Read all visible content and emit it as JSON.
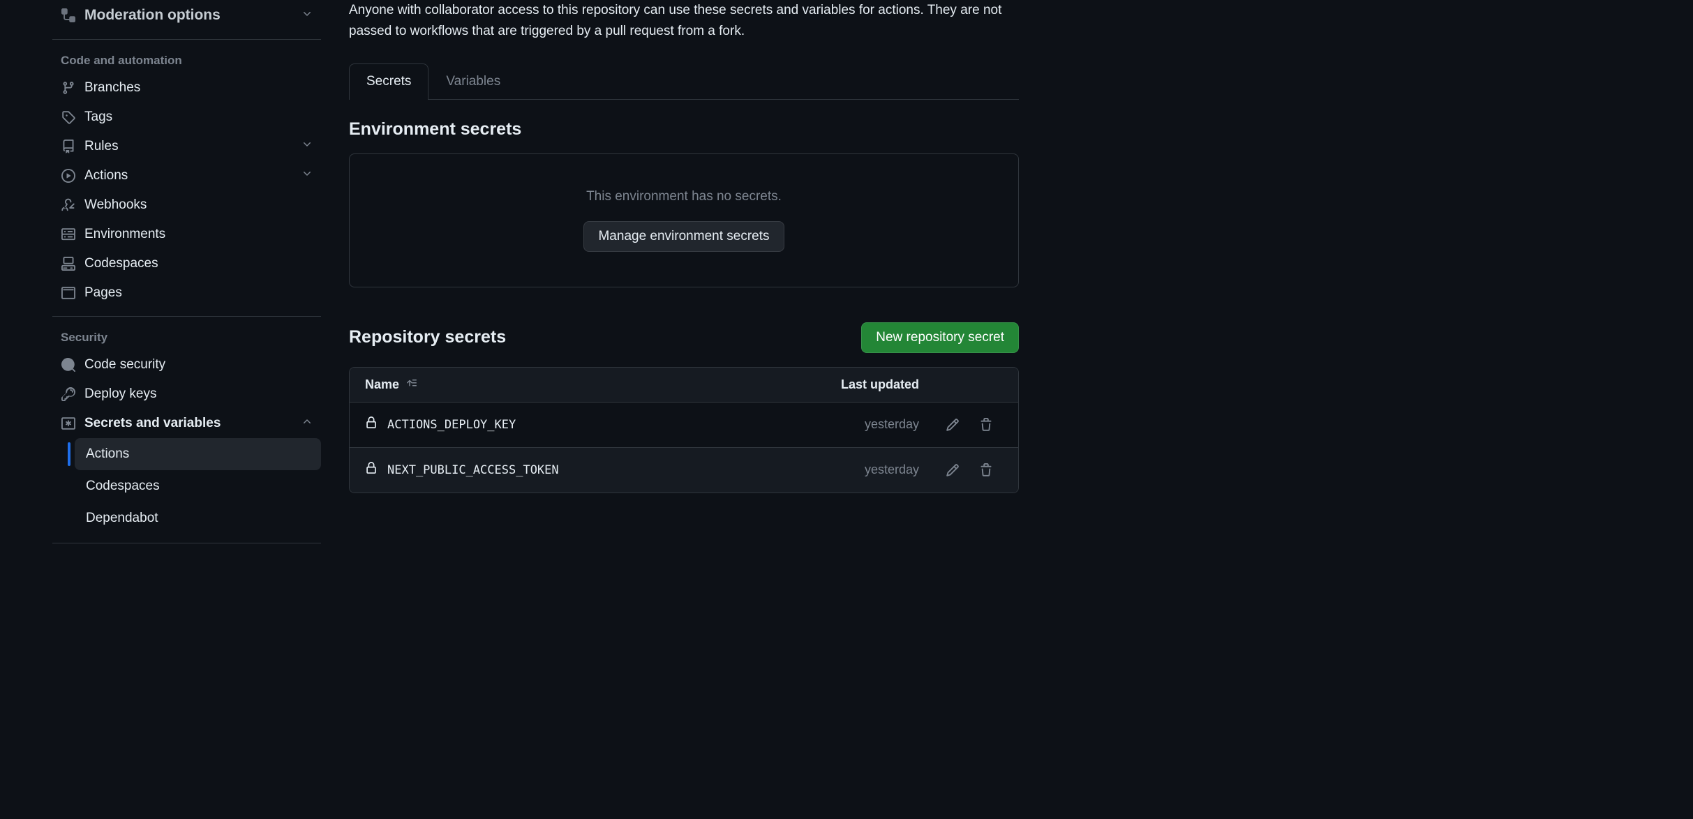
{
  "sidebar": {
    "top_item": "Moderation options",
    "sections": {
      "code_automation": {
        "header": "Code and automation",
        "items": {
          "branches": "Branches",
          "tags": "Tags",
          "rules": "Rules",
          "actions": "Actions",
          "webhooks": "Webhooks",
          "environments": "Environments",
          "codespaces": "Codespaces",
          "pages": "Pages"
        }
      },
      "security": {
        "header": "Security",
        "items": {
          "code_security": "Code security",
          "deploy_keys": "Deploy keys",
          "secrets_vars": "Secrets and variables"
        },
        "sub_items": {
          "actions": "Actions",
          "codespaces": "Codespaces",
          "dependabot": "Dependabot"
        }
      }
    }
  },
  "main": {
    "description": "Anyone with collaborator access to this repository can use these secrets and variables for actions. They are not passed to workflows that are triggered by a pull request from a fork.",
    "tabs": {
      "secrets": "Secrets",
      "variables": "Variables"
    },
    "env_section": {
      "title": "Environment secrets",
      "empty_text": "This environment has no secrets.",
      "manage_btn": "Manage environment secrets"
    },
    "repo_section": {
      "title": "Repository secrets",
      "new_btn": "New repository secret",
      "columns": {
        "name": "Name",
        "updated": "Last updated"
      },
      "rows": [
        {
          "name": "ACTIONS_DEPLOY_KEY",
          "updated": "yesterday"
        },
        {
          "name": "NEXT_PUBLIC_ACCESS_TOKEN",
          "updated": "yesterday"
        }
      ]
    }
  }
}
